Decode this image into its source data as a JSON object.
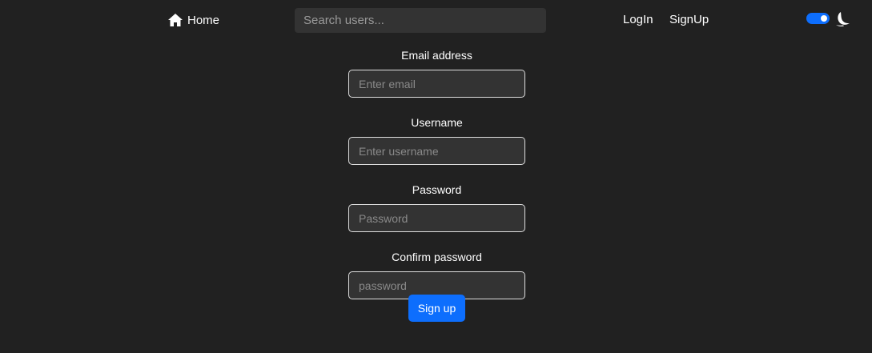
{
  "nav": {
    "home_label": "Home",
    "search_placeholder": "Search users...",
    "login_label": "LogIn",
    "signup_label": "SignUp",
    "theme_toggle_on": true
  },
  "form": {
    "email_label": "Email address",
    "email_placeholder": "Enter email",
    "username_label": "Username",
    "username_placeholder": "Enter username",
    "password_label": "Password",
    "password_placeholder": "Password",
    "confirm_label": "Confirm password",
    "confirm_placeholder": "password",
    "submit_label": "Sign up"
  },
  "colors": {
    "background": "#212121",
    "accent": "#0d6efd",
    "input_bg": "#333333"
  },
  "icons": {
    "home": "home-icon",
    "theme": "moon-icon"
  }
}
